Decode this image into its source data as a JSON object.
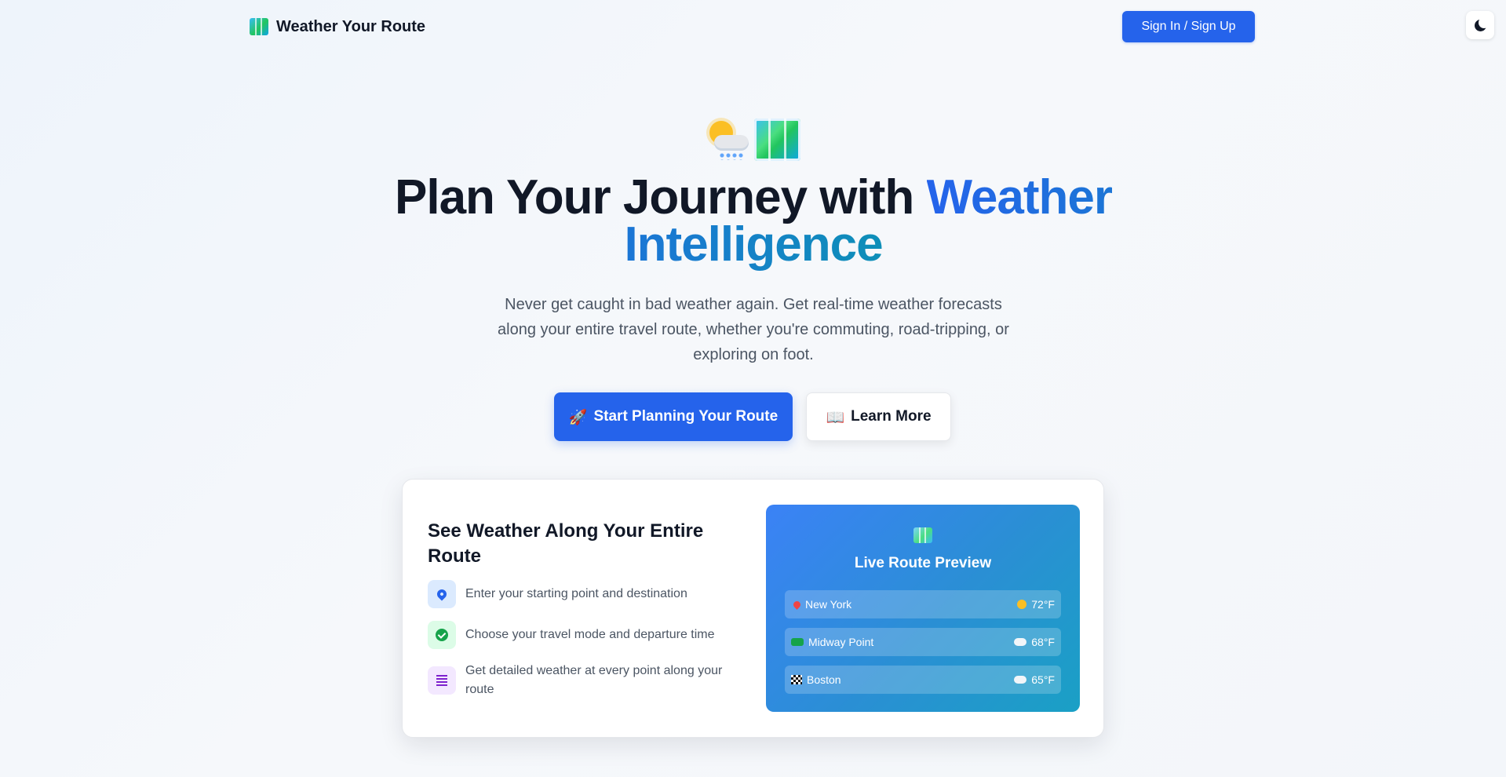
{
  "header": {
    "brand_name": "Weather Your Route",
    "brand_icon": "map-icon",
    "signin_label": "Sign In / Sign Up",
    "theme_toggle_icon": "moon-icon"
  },
  "hero": {
    "emoji_icons": [
      "sun-cloud-rain-icon",
      "map-icon"
    ],
    "title_main": "Plan Your Journey with ",
    "title_accent": "Weather Intelligence",
    "subtitle": "Never get caught in bad weather again. Get real-time weather forecasts along your entire travel route, whether you're commuting, road-tripping, or exploring on foot.",
    "primary_cta": {
      "emoji": "🚀",
      "label": "Start Planning Your Route"
    },
    "secondary_cta": {
      "emoji": "📖",
      "label": "Learn More"
    }
  },
  "feature": {
    "title": "See Weather Along Your Entire Route",
    "steps": [
      {
        "icon": "location-pin-icon",
        "text": "Enter your starting point and destination"
      },
      {
        "icon": "check-circle-icon",
        "text": "Choose your travel mode and departure time"
      },
      {
        "icon": "list-icon",
        "text": "Get detailed weather at every point along your route"
      }
    ]
  },
  "preview": {
    "title": "Live Route Preview",
    "rows": [
      {
        "icon": "pin-icon",
        "place": "New York",
        "weather_icon": "sun-icon",
        "temp": "72°F"
      },
      {
        "icon": "car-icon",
        "place": "Midway Point",
        "weather_icon": "partly-cloudy-icon",
        "temp": "68°F"
      },
      {
        "icon": "checkered-flag-icon",
        "place": "Boston",
        "weather_icon": "cloud-icon",
        "temp": "65°F"
      }
    ]
  },
  "colors": {
    "primary": "#2563eb",
    "accent_gradient_end": "#0e8fb8",
    "text_dark": "#111827",
    "text_muted": "#4b5563"
  }
}
